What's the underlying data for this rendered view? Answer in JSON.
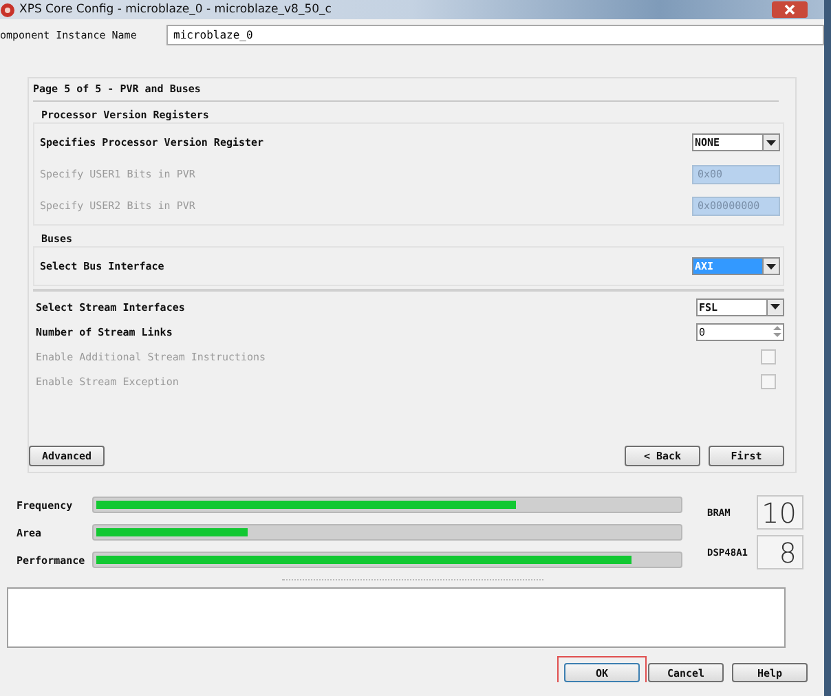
{
  "window": {
    "title": "XPS Core Config - microblaze_0 - microblaze_v8_50_c"
  },
  "component": {
    "label": "omponent Instance Name",
    "value": "microblaze_0"
  },
  "page": {
    "title": "Page 5 of 5 - PVR and Buses",
    "groups": [
      {
        "title": "Processor Version Registers",
        "rows": [
          {
            "kind": "select",
            "label": "Specifies Processor Version Register",
            "value": "NONE",
            "disabled": false,
            "selected": false
          },
          {
            "kind": "text",
            "label": "Specify USER1 Bits in PVR",
            "value": "0x00",
            "disabled": true
          },
          {
            "kind": "text",
            "label": "Specify USER2 Bits in PVR",
            "value": "0x00000000",
            "disabled": true
          }
        ]
      },
      {
        "title": "Buses",
        "rows": [
          {
            "kind": "select",
            "label": "Select Bus Interface",
            "value": "AXI",
            "disabled": false,
            "selected": true
          }
        ]
      }
    ],
    "rows": [
      {
        "kind": "select",
        "label": "Select Stream Interfaces",
        "value": "FSL",
        "disabled": false,
        "selected": false
      },
      {
        "kind": "spinner",
        "label": "Number of Stream Links",
        "value": "0",
        "disabled": false
      },
      {
        "kind": "checkbox",
        "label": "Enable Additional Stream Instructions",
        "checked": false,
        "disabled": true
      },
      {
        "kind": "checkbox",
        "label": "Enable Stream Exception",
        "checked": false,
        "disabled": true
      }
    ],
    "buttons_left": [
      "Advanced"
    ],
    "buttons_right": [
      "< Back",
      "First"
    ]
  },
  "meters": [
    {
      "label": "Frequency",
      "level": 0.72
    },
    {
      "label": "Area",
      "level": 0.26
    },
    {
      "label": "Performance",
      "level": 0.92
    }
  ],
  "counters": [
    {
      "label": "BRAM",
      "value": "10"
    },
    {
      "label": "DSP48A1",
      "value": "8"
    }
  ],
  "buttons": [
    {
      "label": "OK",
      "highlighted": true
    },
    {
      "label": "Cancel",
      "highlighted": false
    },
    {
      "label": "Help",
      "highlighted": false
    }
  ]
}
